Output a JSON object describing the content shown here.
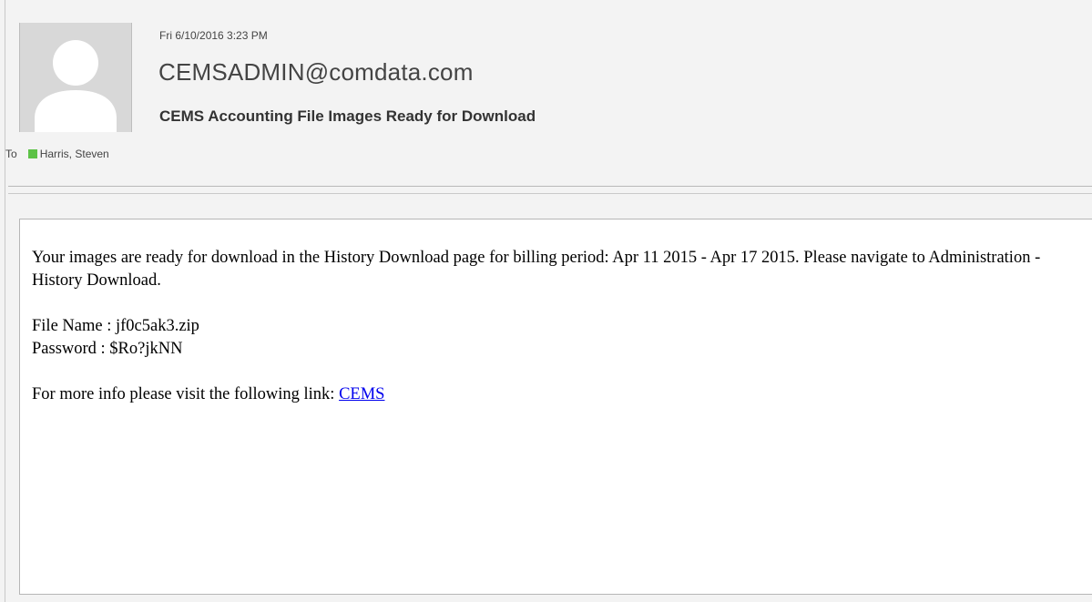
{
  "message": {
    "date": "Fri 6/10/2016 3:23 PM",
    "sender": "CEMSADMIN@comdata.com",
    "subject": "CEMS Accounting File Images Ready for Download",
    "to_label": "To",
    "recipient": "Harris, Steven",
    "presence_color": "#5dc247"
  },
  "body": {
    "paragraph1": "Your images are ready for download in the History Download page for billing period: Apr 11 2015 - Apr 17 2015. Please navigate to Administration - History Download.",
    "file_name_line": "File Name : jf0c5ak3.zip",
    "password_line": "Password : $Ro?jkNN",
    "link_intro": "For more info please visit the following link: ",
    "link_text": "CEMS"
  },
  "icons": {
    "avatar": "person-silhouette-icon",
    "presence": "presence-status-icon"
  }
}
